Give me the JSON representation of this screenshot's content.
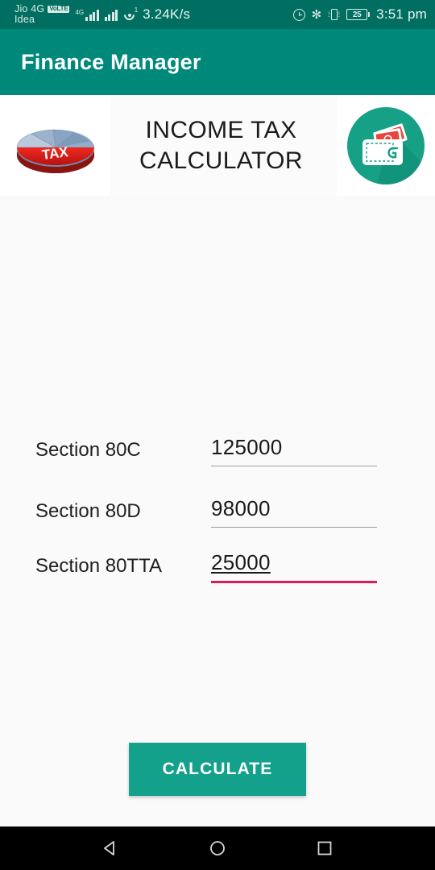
{
  "status_bar": {
    "carrier_primary": "Jio 4G",
    "volte_badge": "VoLTE",
    "carrier_secondary": "Idea",
    "network_tag": "4G",
    "hotspot_superscript": "1",
    "data_rate": "3.24K/s",
    "battery_level": "25",
    "time": "3:51 pm",
    "icons": [
      "alarm-icon",
      "bluetooth-icon",
      "vibrate-icon",
      "battery-icon"
    ],
    "bluetooth_glyph": "✻",
    "background_color": "#006f61"
  },
  "app_bar": {
    "title": "Finance Manager",
    "background_color": "#00897B",
    "text_color": "#FFFFFF"
  },
  "banner": {
    "pie_icon_label": "TAX",
    "title_line_1": "INCOME TAX",
    "title_line_2": "CALCULATOR",
    "wallet_icon": "wallet-icon",
    "wallet_circle_color": "#16A085"
  },
  "form": {
    "fields": [
      {
        "label": "Section 80C",
        "value": "125000",
        "focused": false
      },
      {
        "label": "Section 80D",
        "value": "98000",
        "focused": false
      },
      {
        "label": "Section 80TTA",
        "value": "25000",
        "focused": true
      }
    ],
    "focus_underline_color": "#D81B60",
    "idle_underline_color": "#9E9E9E"
  },
  "actions": {
    "calculate_label": "CALCULATE",
    "calculate_color": "#13A18C"
  },
  "nav_bar": {
    "back": "back-icon",
    "home": "home-icon",
    "recents": "recents-icon",
    "background_color": "#000000"
  }
}
